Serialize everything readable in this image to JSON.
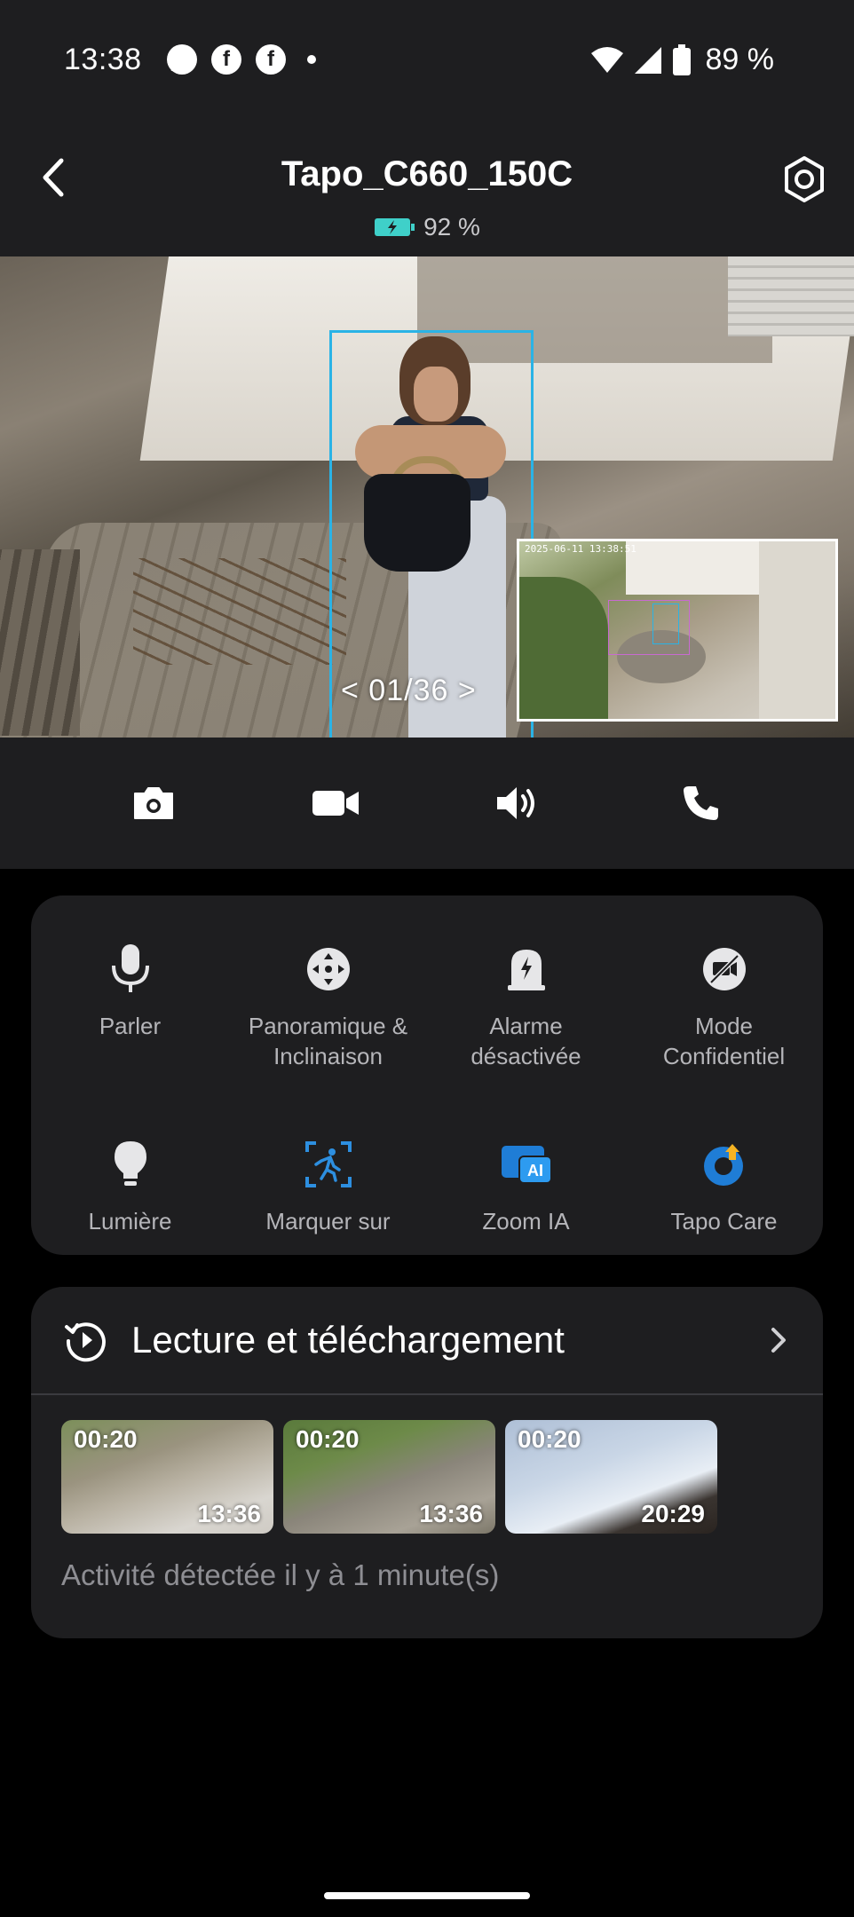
{
  "status_bar": {
    "time": "13:38",
    "notifications": [
      "whatsapp-icon",
      "facebook-icon",
      "facebook-icon"
    ],
    "battery_percent": "89 %"
  },
  "header": {
    "title": "Tapo_C660_150C",
    "camera_battery": "92 %",
    "camera_battery_level": 0.92
  },
  "video": {
    "pager": "<  01/36  >",
    "pip_timestamp": "2025-06-11 13:38:51"
  },
  "controls": [
    {
      "icon": "camera-icon",
      "label": "Capture"
    },
    {
      "icon": "video-record-icon",
      "label": "Record"
    },
    {
      "icon": "speaker-icon",
      "label": "Sound"
    },
    {
      "icon": "phone-icon",
      "label": "Call"
    }
  ],
  "features": [
    {
      "icon": "microphone-icon",
      "label": "Parler"
    },
    {
      "icon": "pan-tilt-icon",
      "label": "Panoramique &\nInclinaison"
    },
    {
      "icon": "alarm-icon",
      "label": "Alarme\ndésactivée"
    },
    {
      "icon": "privacy-icon",
      "label": "Mode\nConfidentiel"
    },
    {
      "icon": "lightbulb-icon",
      "label": "Lumière"
    },
    {
      "icon": "mark-on-icon",
      "label": "Marquer sur"
    },
    {
      "icon": "ai-zoom-icon",
      "label": "Zoom IA"
    },
    {
      "icon": "tapo-care-icon",
      "label": "Tapo Care"
    }
  ],
  "playback": {
    "title": "Lecture et téléchargement",
    "thumbnails": [
      {
        "duration": "00:20",
        "time": "13:36"
      },
      {
        "duration": "00:20",
        "time": "13:36"
      },
      {
        "duration": "00:20",
        "time": "20:29"
      }
    ],
    "activity": "Activité détectée il y à 1 minute(s)"
  },
  "colors": {
    "accent": "#2ab3e6",
    "card": "#1e1e20",
    "background": "#000000",
    "label": "#b5b5b9"
  }
}
